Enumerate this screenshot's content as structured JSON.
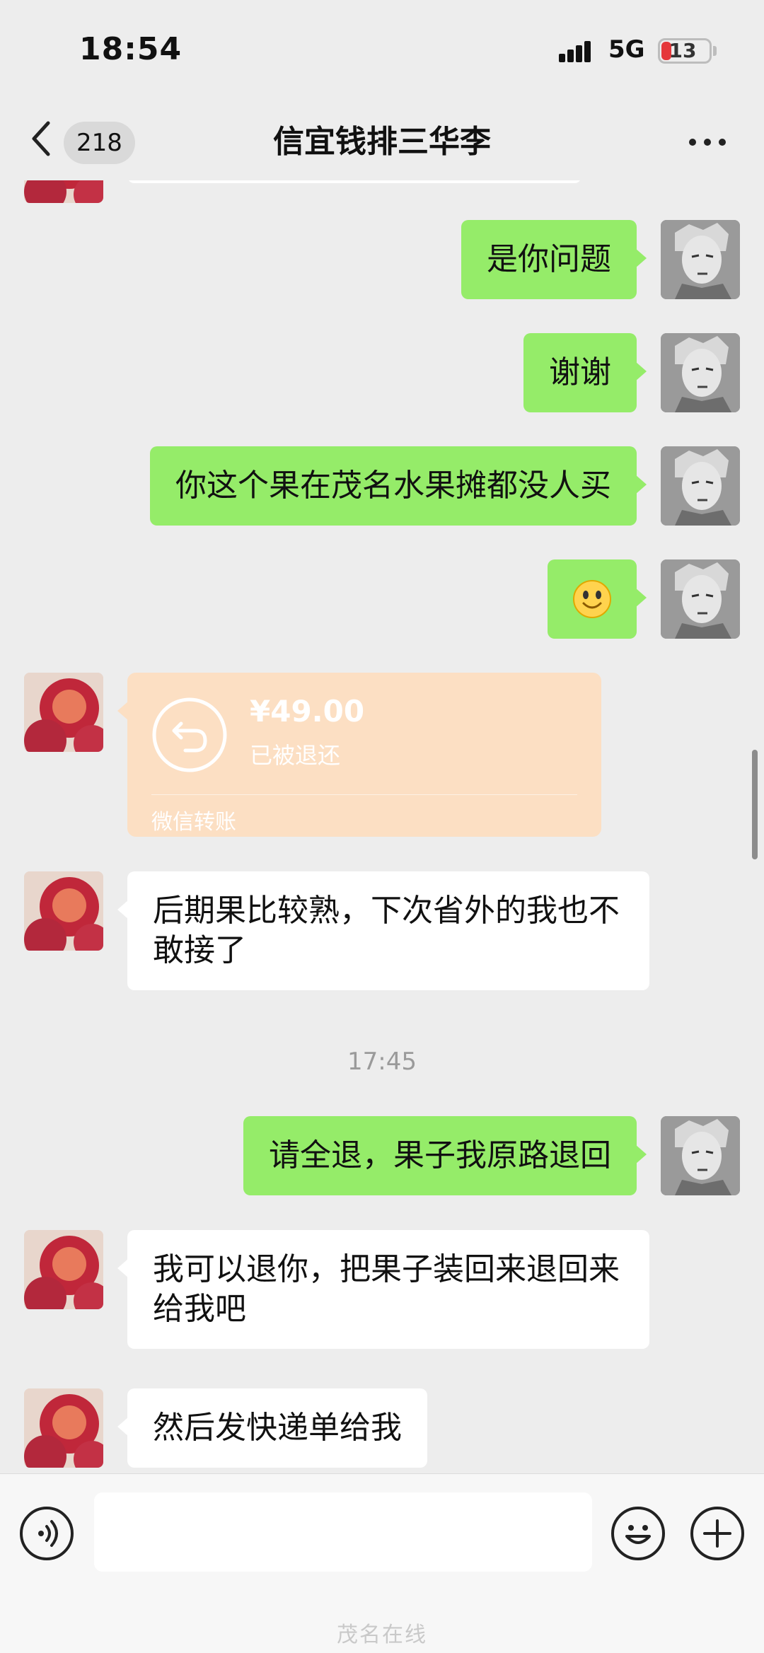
{
  "status_bar": {
    "time": "18:54",
    "network": "5G",
    "battery": "13",
    "battery_color": "#e5373a"
  },
  "nav": {
    "back_icon": "chevron-left-icon",
    "unread_count": "218",
    "title": "信宜钱排三华李",
    "more_icon": "more-dots-icon"
  },
  "messages": [
    {
      "side": "me",
      "text": "是你问题"
    },
    {
      "side": "me",
      "text": "谢谢"
    },
    {
      "side": "me",
      "text": "你这个果在茂名水果摊都没人买"
    },
    {
      "side": "me",
      "emoji": "🙂"
    },
    {
      "side": "them",
      "type": "transfer",
      "amount": "¥49.00",
      "status": "已被退还",
      "label": "微信转账"
    },
    {
      "side": "them",
      "text": "后期果比较熟，下次省外的我也不敢接了"
    },
    {
      "side": "system",
      "text": "17:45"
    },
    {
      "side": "me",
      "text": "请全退，果子我原路退回"
    },
    {
      "side": "them",
      "text": "我可以退你，把果子装回来退回来给我吧"
    },
    {
      "side": "them",
      "text": "然后发快递单给我"
    }
  ],
  "input_bar": {
    "voice_icon": "voice-icon",
    "emoji_icon": "emoji-icon",
    "plus_icon": "plus-icon",
    "input_value": "",
    "watermark": "茂名在线"
  },
  "colors": {
    "my_bubble": "#95ec69",
    "their_bubble": "#ffffff",
    "transfer_bubble": "#fcdfc3",
    "background": "#ededed"
  }
}
